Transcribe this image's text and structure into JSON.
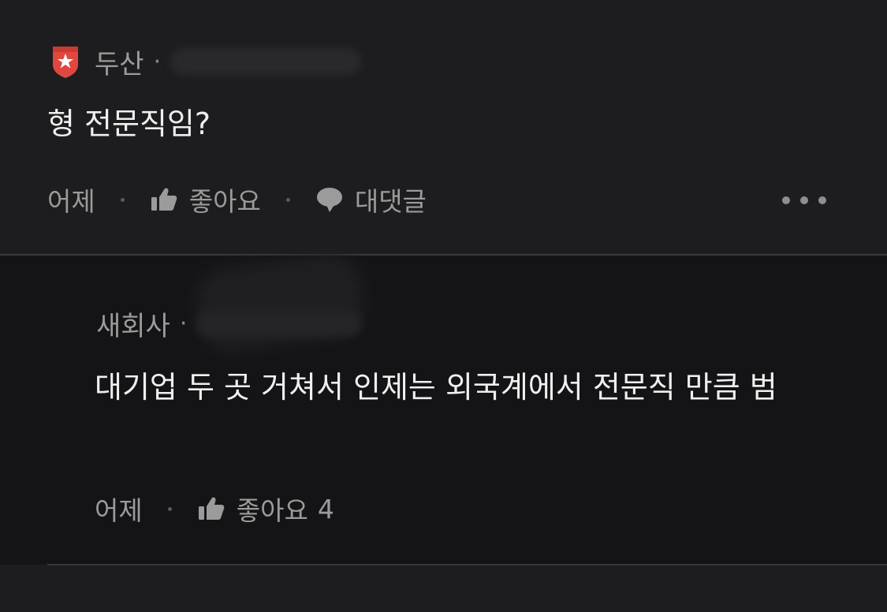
{
  "top_comment": {
    "company": "두산",
    "body": "형 전문직임?",
    "time": "어제",
    "like_label": "좋아요",
    "reply_label": "대댓글"
  },
  "reply": {
    "company": "새회사",
    "body": "대기업 두 곳 거쳐서 인제는 외국계에서 전문직 만큼 범",
    "time": "어제",
    "like_label": "좋아요",
    "like_count": "4"
  },
  "colors": {
    "background": "#1d1d1f",
    "reply_background": "#141416",
    "badge_red": "#e0473f",
    "muted_text": "#9b9b9b"
  },
  "icons": {
    "company_badge": "red-shield-star-icon",
    "like": "thumbs-up-icon",
    "reply": "speech-bubble-icon",
    "more": "more-dots-icon"
  }
}
